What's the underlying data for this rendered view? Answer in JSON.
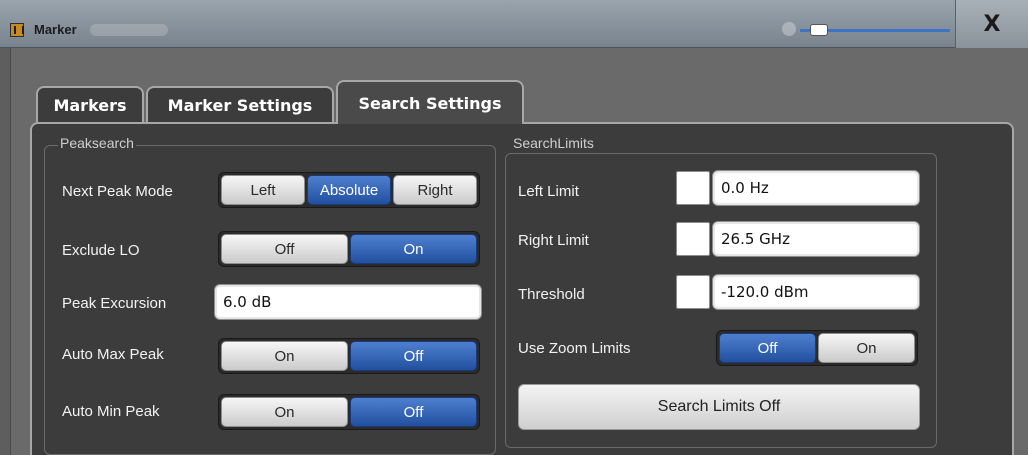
{
  "window": {
    "title": "Marker",
    "close_glyph": "X"
  },
  "tabs": [
    {
      "label": "Markers",
      "active": false
    },
    {
      "label": "Marker Settings",
      "active": false
    },
    {
      "label": "Search Settings",
      "active": true
    }
  ],
  "peaksearch": {
    "title": "Peaksearch",
    "next_peak_mode": {
      "label": "Next Peak Mode",
      "options": [
        "Left",
        "Absolute",
        "Right"
      ],
      "selected": "Absolute"
    },
    "exclude_lo": {
      "label": "Exclude LO",
      "options": [
        "Off",
        "On"
      ],
      "selected": "On"
    },
    "peak_excursion": {
      "label": "Peak Excursion",
      "value": "6.0 dB"
    },
    "auto_max_peak": {
      "label": "Auto Max Peak",
      "options": [
        "On",
        "Off"
      ],
      "selected": "Off"
    },
    "auto_min_peak": {
      "label": "Auto Min Peak",
      "options": [
        "On",
        "Off"
      ],
      "selected": "Off"
    }
  },
  "search_limits": {
    "title": "SearchLimits",
    "left_limit": {
      "label": "Left Limit",
      "value": "0.0 Hz"
    },
    "right_limit": {
      "label": "Right Limit",
      "value": "26.5 GHz"
    },
    "threshold": {
      "label": "Threshold",
      "value": "-120.0 dBm"
    },
    "use_zoom_limits": {
      "label": "Use Zoom Limits",
      "options": [
        "Off",
        "On"
      ],
      "selected": "Off"
    },
    "search_limits_off_label": "Search Limits Off"
  },
  "colors": {
    "accent": "#2f5fb4",
    "panel_bg": "#3c3c3c",
    "frame_bg": "#6a6a6a"
  }
}
